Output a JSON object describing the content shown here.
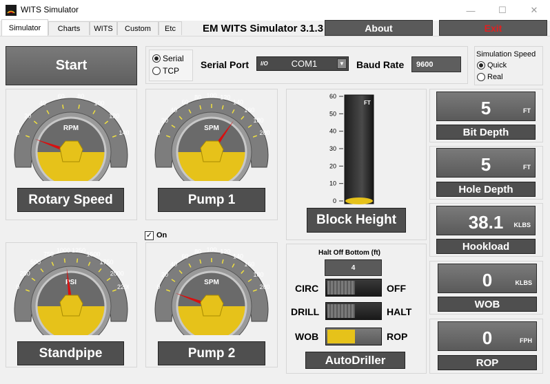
{
  "window": {
    "title": "WITS Simulator",
    "minimize": "—",
    "maximize": "☐",
    "close": "✕"
  },
  "tabs": [
    "Simulator",
    "Charts",
    "WITS",
    "Custom",
    "Etc"
  ],
  "header": {
    "app_title": "EM WITS Simulator 3.1.3",
    "about": "About",
    "exit": "Exit"
  },
  "controls": {
    "start": "Start",
    "connection": {
      "serial": "Serial",
      "tcp": "TCP",
      "selected": "Serial"
    },
    "serial_port_label": "Serial Port",
    "serial_port_value": "COM1",
    "serial_port_prefix": "I/O",
    "baud_label": "Baud Rate",
    "baud_value": "9600",
    "sim_speed": {
      "title": "Simulation Speed",
      "quick": "Quick",
      "real": "Real",
      "selected": "Quick"
    }
  },
  "gauges": {
    "rotary": {
      "label": "Rotary Speed",
      "unit": "RPM",
      "ticks": [
        "0",
        "20",
        "40",
        "60",
        "80",
        "100",
        "120",
        "140"
      ],
      "value": 0
    },
    "pump1": {
      "label": "Pump 1",
      "unit": "SPM",
      "ticks": [
        "0",
        "20",
        "40",
        "60",
        "80",
        "100",
        "120",
        "140",
        "160",
        "180",
        "200"
      ],
      "value": 150
    },
    "standpipe": {
      "label": "Standpipe",
      "unit": "PSI",
      "ticks": [
        "0",
        "250",
        "500",
        "750",
        "1000",
        "1250",
        "1500",
        "1750",
        "2000",
        "2200"
      ],
      "value": 1000
    },
    "pump2": {
      "label": "Pump 2",
      "unit": "SPM",
      "ticks": [
        "0",
        "20",
        "40",
        "60",
        "80",
        "100",
        "120",
        "140",
        "160",
        "180",
        "200"
      ],
      "value": 0
    }
  },
  "pump2_on": {
    "label": "On",
    "checked": true
  },
  "block_height": {
    "label": "Block Height",
    "unit": "FT",
    "ticks": [
      "60",
      "50",
      "40",
      "30",
      "20",
      "10",
      "0"
    ],
    "value": 0
  },
  "autodriller": {
    "halt_label": "Halt Off Bottom (ft)",
    "halt_value": "4",
    "rows": [
      {
        "left": "CIRC",
        "right": "OFF",
        "state": "left"
      },
      {
        "left": "DRILL",
        "right": "HALT",
        "state": "left"
      },
      {
        "left": "WOB",
        "right": "ROP",
        "state": "left-active"
      }
    ],
    "button": "AutoDriller"
  },
  "readouts": [
    {
      "value": "5",
      "unit": "FT",
      "label": "Bit Depth"
    },
    {
      "value": "5",
      "unit": "FT",
      "label": "Hole Depth"
    },
    {
      "value": "38.1",
      "unit": "KLBS",
      "label": "Hookload"
    },
    {
      "value": "0",
      "unit": "KLBS",
      "label": "WOB"
    },
    {
      "value": "0",
      "unit": "FPH",
      "label": "ROP"
    }
  ],
  "colors": {
    "accent_yellow": "#e6c21a",
    "needle_red": "#d81010",
    "exit_red": "#e02020"
  }
}
